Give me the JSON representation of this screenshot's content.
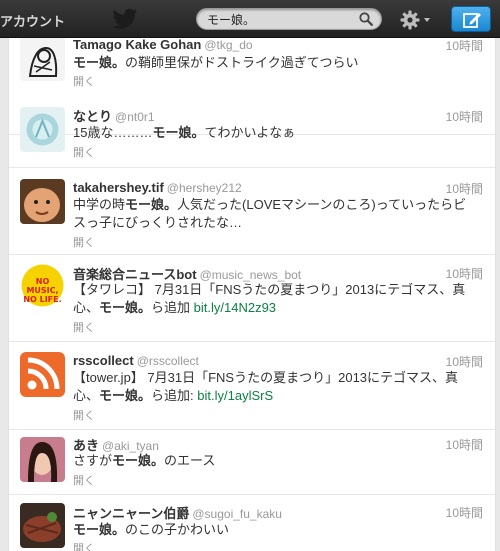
{
  "topbar": {
    "account_label": "アカウント",
    "search": {
      "value": "モー娘。"
    }
  },
  "tweets": [
    {
      "name": "Tamago Kake Gohan",
      "handle": "@tkg_do",
      "time": "10時間",
      "parts": [
        {
          "b": "モー娘。"
        },
        {
          "t": "の鞘師里保がドストライク過ぎてつらい"
        }
      ],
      "expand": "開く"
    },
    {
      "name": "なとり",
      "handle": "@nt0r1",
      "time": "10時間",
      "parts": [
        {
          "t": "15歳な………"
        },
        {
          "b": "モー娘。"
        },
        {
          "t": "てわかいよなぁ"
        }
      ],
      "expand": "開く"
    },
    {
      "name": "takahershey.tif",
      "handle": "@hershey212",
      "time": "10時間",
      "parts": [
        {
          "t": "中学の時"
        },
        {
          "b": "モー娘。"
        },
        {
          "t": "人気だった(LOVEマシーンのころ)っていったらビスっ子にびっくりされたな…"
        }
      ],
      "expand": "開く"
    },
    {
      "name": "音楽総合ニュースbot",
      "handle": "@music_news_bot",
      "time": "10時間",
      "parts": [
        {
          "t": "【タワレコ】 7月31日「FNSうたの夏まつり」2013にテゴマス、真心、"
        },
        {
          "b": "モー娘。"
        },
        {
          "t": "ら追加 "
        },
        {
          "l": "bit.ly/14N2z93"
        }
      ],
      "expand": "開く"
    },
    {
      "name": "rsscollect",
      "handle": "@rsscollect",
      "time": "10時間",
      "parts": [
        {
          "t": "【tower.jp】 7月31日「FNSうたの夏まつり」2013にテゴマス、真心、"
        },
        {
          "b": "モー娘。"
        },
        {
          "t": "ら追加: "
        },
        {
          "l": "bit.ly/1aylSrS"
        }
      ],
      "expand": "開く"
    },
    {
      "name": "あき",
      "handle": "@aki_tyan",
      "time": "10時間",
      "parts": [
        {
          "t": "さすが"
        },
        {
          "b": "モー娘。"
        },
        {
          "t": "のエース"
        }
      ],
      "expand": "開く"
    },
    {
      "name": "ニャンニャーン伯爵",
      "handle": "@sugoi_fu_kaku",
      "time": "10時間",
      "parts": [
        {
          "b": "モー娘。"
        },
        {
          "t": "のこの子かわいい"
        }
      ],
      "expand": "開く"
    }
  ],
  "avatars": {
    "music_badge": "NO MUSIC, NO LIFE."
  },
  "colors": {
    "topbar": "#2b2b2b",
    "compose": "#1a86d0",
    "link": "#0d8044",
    "rss": "#ee6a2b"
  }
}
